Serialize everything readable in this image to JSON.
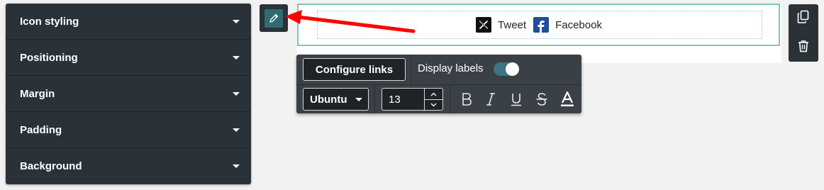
{
  "accordion": {
    "items": [
      {
        "label": "Icon styling"
      },
      {
        "label": "Positioning"
      },
      {
        "label": "Margin"
      },
      {
        "label": "Padding"
      },
      {
        "label": "Background"
      }
    ]
  },
  "widget": {
    "tweet_label": "Tweet",
    "facebook_label": "Facebook"
  },
  "toolbar": {
    "configure_links_label": "Configure links",
    "display_labels_text": "Display labels",
    "display_labels_on": true,
    "font_family": "Ubuntu",
    "font_size": "13"
  },
  "icons": [
    "pencil-icon",
    "x-logo-icon",
    "facebook-logo-icon",
    "duplicate-icon",
    "trash-icon",
    "bold-icon",
    "italic-icon",
    "underline-icon",
    "strikethrough-icon",
    "text-color-icon"
  ],
  "colors": {
    "panel_bg": "#2b3237",
    "accent_teal": "#2f6b73",
    "widget_border": "#7fc7ae",
    "toggle_track": "#3e7382",
    "arrow": "#ff0000"
  }
}
